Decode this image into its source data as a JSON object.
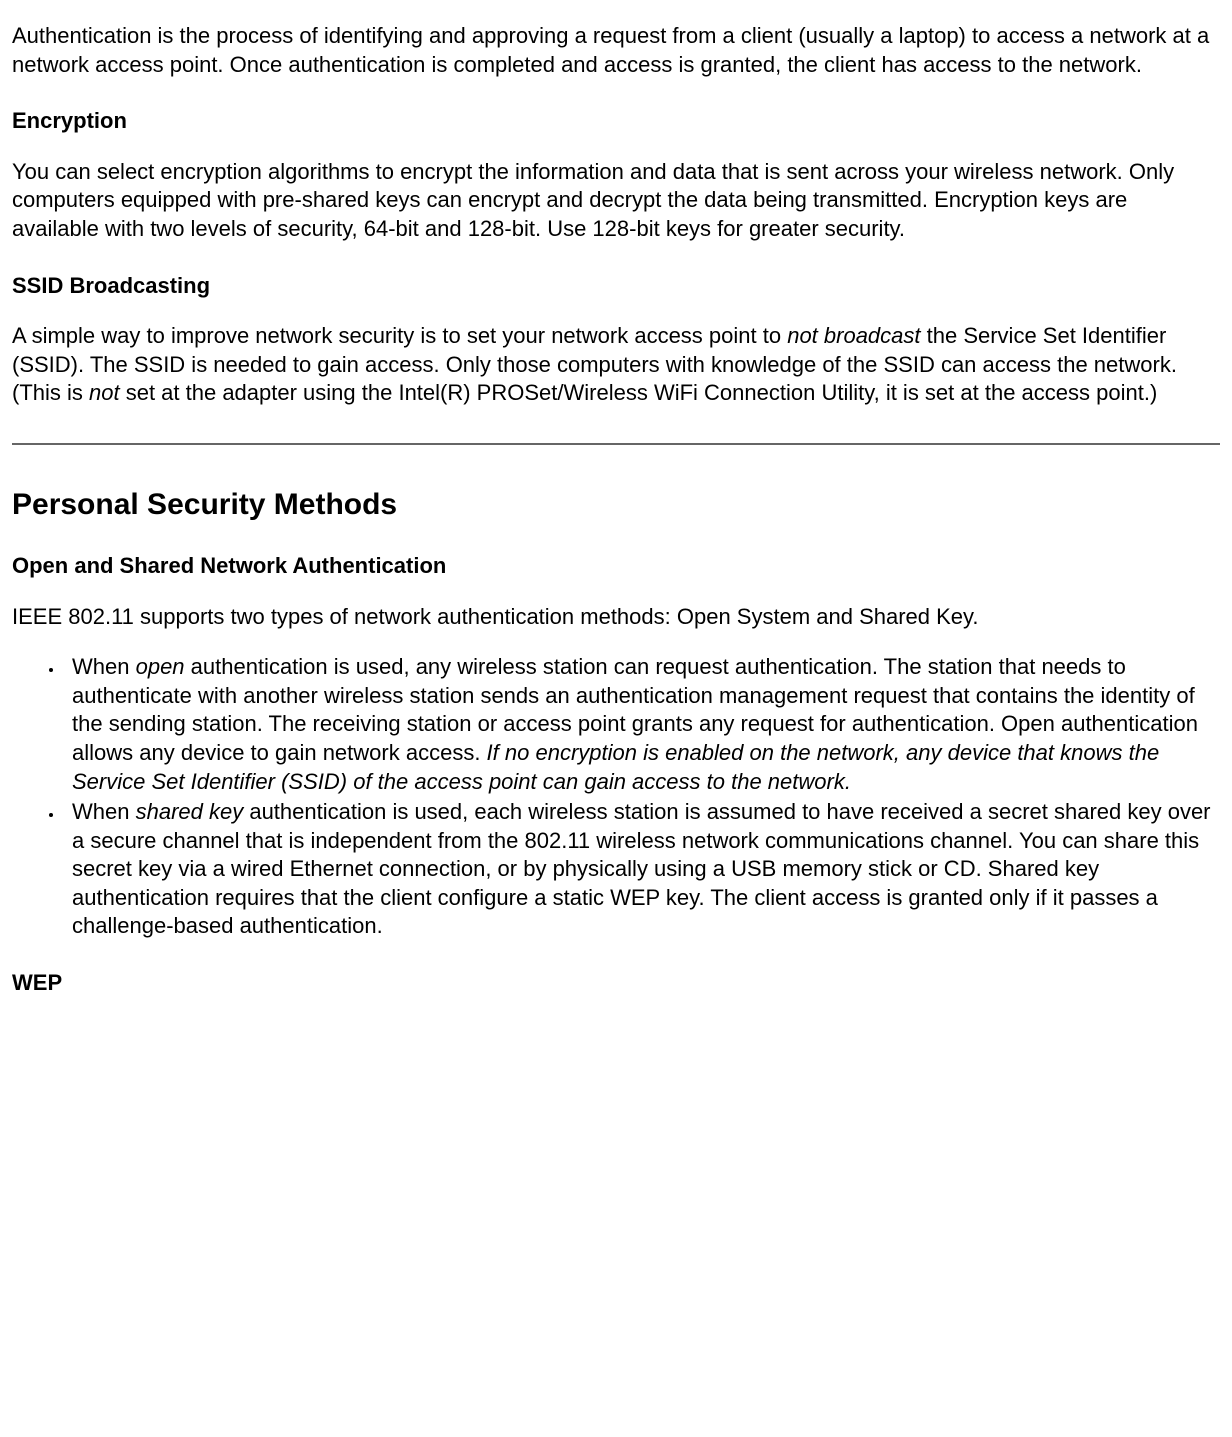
{
  "para_auth": "Authentication is the process of identifying and approving a request from a client (usually a laptop) to access a network at a network access point. Once authentication is completed and access is granted, the client has access to the network.",
  "h_encryption": "Encryption",
  "para_encryption": "You can select encryption algorithms to encrypt the information and data that is sent across your wireless network. Only computers equipped with pre-shared keys can encrypt and decrypt the data being transmitted. Encryption keys are available with two levels of security, 64-bit and 128-bit. Use 128-bit keys for greater security.",
  "h_ssid": "SSID Broadcasting",
  "ssid_1": "A simple way to improve network security is to set your network access point to ",
  "ssid_i1": "not broadcast",
  "ssid_2": " the Service Set Identifier (SSID). The SSID is needed to gain access. Only those computers with knowledge of the SSID can access the network. (This is ",
  "ssid_i2": "not",
  "ssid_3": " set at the adapter using the Intel(R) PROSet/Wireless WiFi Connection Utility, it is set at the access point.)",
  "h_personal": "Personal Security Methods",
  "h_openshared": "Open and Shared Network Authentication",
  "para_ieee": "IEEE 802.11 supports two types of network authentication methods: Open System and Shared Key.",
  "li1_1": "When ",
  "li1_i1": "open",
  "li1_2": " authentication is used, any wireless station can request authentication. The station that needs to authenticate with another wireless station sends an authentication management request that contains the identity of the sending station. The receiving station or access point grants any request for authentication. Open authentication allows any device to gain network access. ",
  "li1_i2": "If no encryption is enabled on the network, any device that knows the Service Set Identifier (SSID) of the access point can gain access to the network.",
  "li2_1": "When ",
  "li2_i1": "shared key",
  "li2_2": " authentication is used, each wireless station is assumed to have received a secret shared key over a secure channel that is independent from the 802.11 wireless network communications channel. You can share this secret key via a wired Ethernet connection, or by physically using a USB memory stick or CD. Shared key authentication requires that the client configure a static WEP key. The client access is granted only if it passes a challenge-based authentication.",
  "h_wep": "WEP"
}
